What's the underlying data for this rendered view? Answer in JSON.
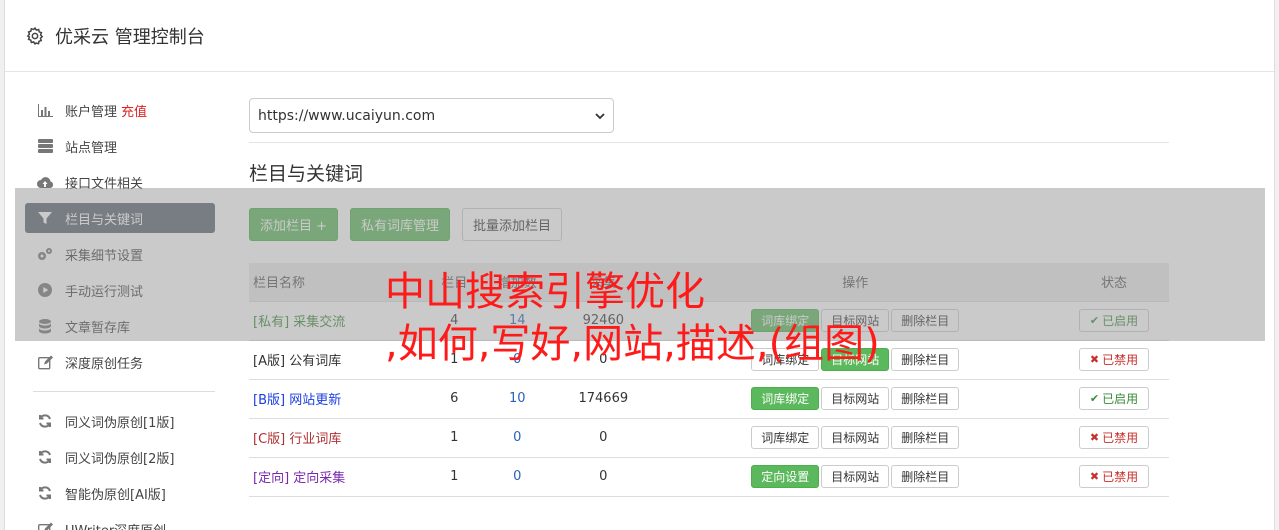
{
  "header": {
    "title": "优采云 管理控制台",
    "icon": "gear-icon"
  },
  "sidebar": {
    "items": [
      {
        "label": "账户管理",
        "extra": "充值",
        "icon": "bar-chart-icon",
        "active": false
      },
      {
        "label": "站点管理",
        "icon": "server-icon",
        "active": false
      },
      {
        "label": "接口文件相关",
        "icon": "cloud-upload-icon",
        "active": false
      },
      {
        "label": "栏目与关键词",
        "icon": "filter-icon",
        "active": true
      },
      {
        "label": "采集细节设置",
        "icon": "cogs-icon",
        "active": false
      },
      {
        "label": "手动运行测试",
        "icon": "play-circle-icon",
        "active": false
      },
      {
        "label": "文章暂存库",
        "icon": "database-icon",
        "active": false
      },
      {
        "label": "深度原创任务",
        "icon": "edit-icon",
        "active": false
      }
    ],
    "items2": [
      {
        "label": "同义词伪原创[1版]",
        "icon": "refresh-icon"
      },
      {
        "label": "同义词伪原创[2版]",
        "icon": "refresh-icon"
      },
      {
        "label": "智能伪原创[AI版]",
        "icon": "refresh-icon"
      },
      {
        "label": "UWriter深度原创",
        "icon": "edit-icon"
      }
    ]
  },
  "main": {
    "site_select": {
      "value": "https://www.ucaiyun.com"
    },
    "section_title": "栏目与关键词",
    "buttons": {
      "add_column": "添加栏目 +",
      "private_lib": "私有词库管理",
      "batch_add": "批量添加栏目"
    },
    "table": {
      "headers": [
        "栏目名称",
        "栏目",
        "增加数",
        "采集",
        "操作",
        "状态"
      ],
      "rows": [
        {
          "prefix": "[私有]",
          "name": "采集交流",
          "n1": "4",
          "n2": "14",
          "n3": "92460",
          "op1": "词库绑定",
          "op1_green": true,
          "op2": "目标网站",
          "op2_green": false,
          "op3": "删除栏目",
          "status": "已启用",
          "on": true
        },
        {
          "prefix": "[A版]",
          "name": "公有词库",
          "n1": "1",
          "n2": "0",
          "n3": "0",
          "op1": "词库绑定",
          "op1_green": false,
          "op2": "目标网站",
          "op2_green": true,
          "op3": "删除栏目",
          "status": "已禁用",
          "on": false
        },
        {
          "prefix": "[B版]",
          "name": "网站更新",
          "n1": "6",
          "n2": "10",
          "n3": "174669",
          "op1": "词库绑定",
          "op1_green": true,
          "op2": "目标网站",
          "op2_green": false,
          "op3": "删除栏目",
          "status": "已启用",
          "on": true
        },
        {
          "prefix": "[C版]",
          "name": "行业词库",
          "n1": "1",
          "n2": "0",
          "n3": "0",
          "op1": "词库绑定",
          "op1_green": false,
          "op2": "目标网站",
          "op2_green": false,
          "op3": "删除栏目",
          "status": "已禁用",
          "on": false
        },
        {
          "prefix": "[定向]",
          "name": "定向采集",
          "n1": "1",
          "n2": "0",
          "n3": "0",
          "op1": "定向设置",
          "op1_green": true,
          "op2": "目标网站",
          "op2_green": false,
          "op3": "删除栏目",
          "status": "已禁用",
          "on": false
        }
      ]
    }
  },
  "watermark": {
    "line1": "中山搜索引擎优化",
    "line2": ",如何,写好,网站,描述,(组图)"
  },
  "colors": {
    "accent_green": "#5cb85c",
    "active_nav": "#5a6470",
    "watermark_red": "#ff1a1a"
  }
}
